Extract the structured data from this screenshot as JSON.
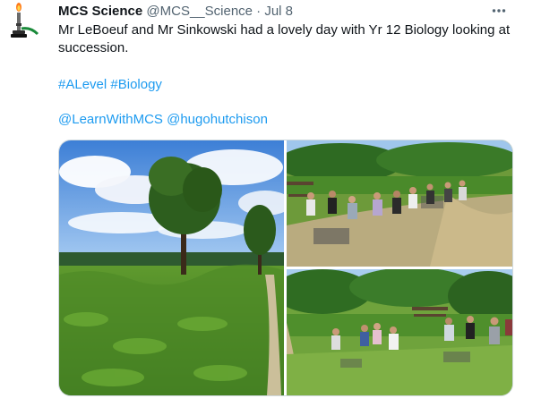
{
  "tweet": {
    "author_name": "MCS Science",
    "author_handle": "@MCS__Science",
    "separator": "·",
    "date": "Jul 8",
    "text": "Mr LeBoeuf and Mr Sinkowski had a lovely day with Yr 12 Biology looking at succession.",
    "hashtags": [
      "#ALevel",
      "#Biology"
    ],
    "mentions": [
      "@LearnWithMCS",
      "@hugohutchison"
    ],
    "more_icon": "more-horizontal-icon",
    "avatar_icon": "bunsen-burner-icon"
  },
  "media": {
    "photos": [
      "forest-landscape-photo",
      "students-seated-on-grass-photo",
      "students-on-hillside-photo"
    ]
  },
  "colors": {
    "link": "#1d9bf0",
    "secondary_text": "#536471",
    "border": "#cfd9de"
  }
}
